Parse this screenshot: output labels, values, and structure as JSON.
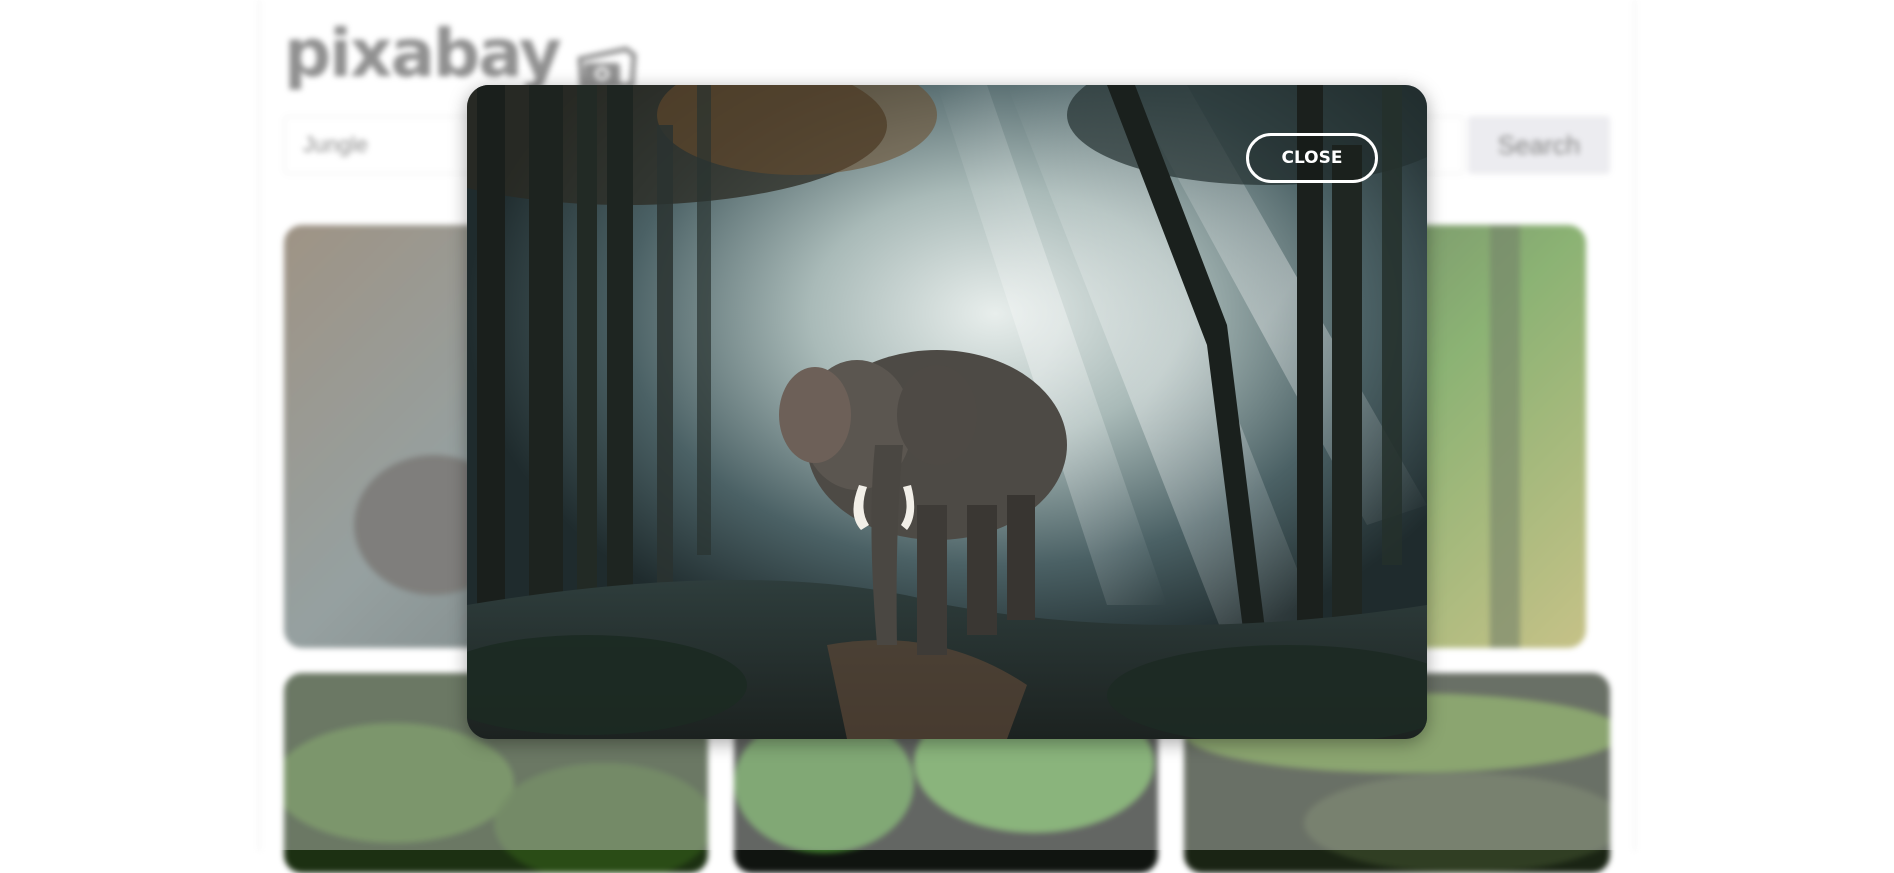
{
  "brand": {
    "name": "pixabay",
    "logo_icon": "camera-icon"
  },
  "search": {
    "value": "Jungle",
    "button_label": "Search"
  },
  "modal": {
    "close_label": "CLOSE"
  },
  "colors": {
    "page_bg": "#ffffff",
    "button_bg": "#e2e2e8",
    "overlay_border": "#ffffff"
  }
}
